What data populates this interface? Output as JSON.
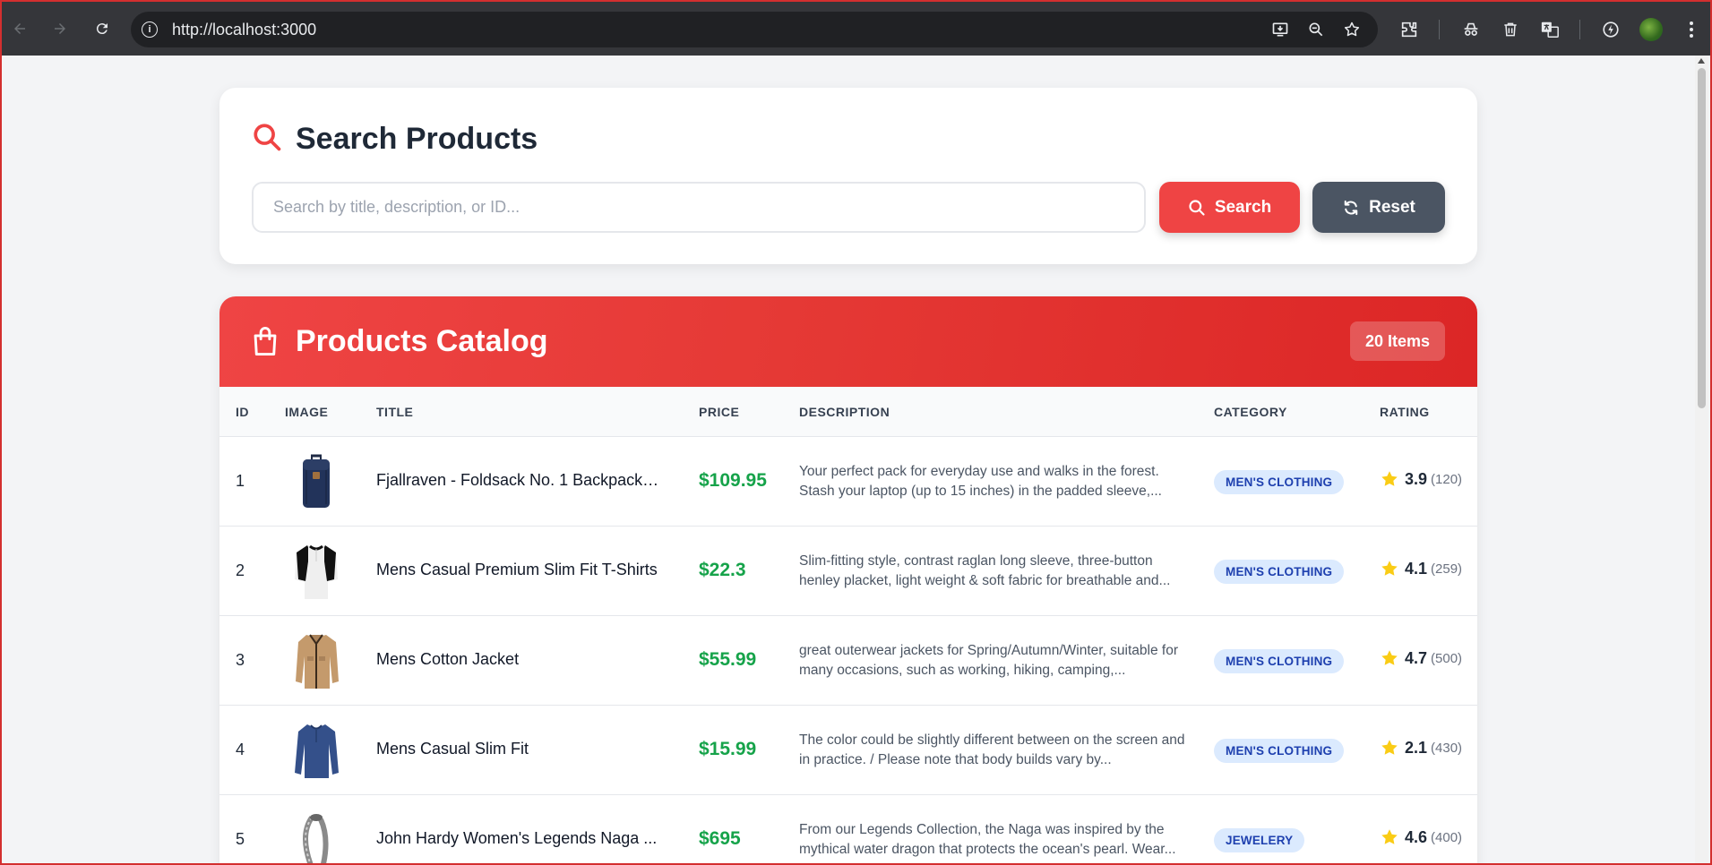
{
  "browser": {
    "url": "http://localhost:3000",
    "info_glyph": "i"
  },
  "search": {
    "title": "Search Products",
    "placeholder": "Search by title, description, or ID...",
    "value": "",
    "search_label": "Search",
    "reset_label": "Reset"
  },
  "catalog": {
    "title": "Products Catalog",
    "count_label": "20 Items",
    "columns": {
      "id": "ID",
      "image": "IMAGE",
      "title": "TITLE",
      "price": "PRICE",
      "description": "DESCRIPTION",
      "category": "CATEGORY",
      "rating": "RATING"
    },
    "rows": [
      {
        "id": "1",
        "image": "backpack-image",
        "title": "Fjallraven - Foldsack No. 1 Backpack, ...",
        "price": "$109.95",
        "description": "Your perfect pack for everyday use and walks in the forest. Stash your laptop (up to 15 inches) in the padded sleeve,...",
        "category": "MEN'S CLOTHING",
        "rate": "3.9",
        "count": "(120)"
      },
      {
        "id": "2",
        "image": "tshirt-image",
        "title": "Mens Casual Premium Slim Fit T-Shirts",
        "price": "$22.3",
        "description": "Slim-fitting style, contrast raglan long sleeve, three-button henley placket, light weight & soft fabric for breathable and...",
        "category": "MEN'S CLOTHING",
        "rate": "4.1",
        "count": "(259)"
      },
      {
        "id": "3",
        "image": "jacket-image",
        "title": "Mens Cotton Jacket",
        "price": "$55.99",
        "description": "great outerwear jackets for Spring/Autumn/Winter, suitable for many occasions, such as working, hiking, camping,...",
        "category": "MEN'S CLOTHING",
        "rate": "4.7",
        "count": "(500)"
      },
      {
        "id": "4",
        "image": "slim-fit-shirt-image",
        "title": "Mens Casual Slim Fit",
        "price": "$15.99",
        "description": "The color could be slightly different between on the screen and in practice. / Please note that body builds vary by...",
        "category": "MEN'S CLOTHING",
        "rate": "2.1",
        "count": "(430)"
      },
      {
        "id": "5",
        "image": "bracelet-image",
        "title": "John Hardy Women's Legends Naga ...",
        "price": "$695",
        "description": "From our Legends Collection, the Naga was inspired by the mythical water dragon that protects the ocean's pearl. Wear...",
        "category": "JEWELERY",
        "rate": "4.6",
        "count": "(400)"
      }
    ]
  },
  "colors": {
    "accent": "#ef4444",
    "reset_button": "#4b5563",
    "price": "#16a34a",
    "category_badge_bg": "#dbeafe",
    "category_badge_text": "#1e40af",
    "star": "#facc15"
  },
  "icons": {
    "title_search": "search-icon",
    "catalog": "shopping-bag-icon",
    "search_button": "search-icon",
    "reset_button": "refresh-icon",
    "rating": "star-icon"
  }
}
